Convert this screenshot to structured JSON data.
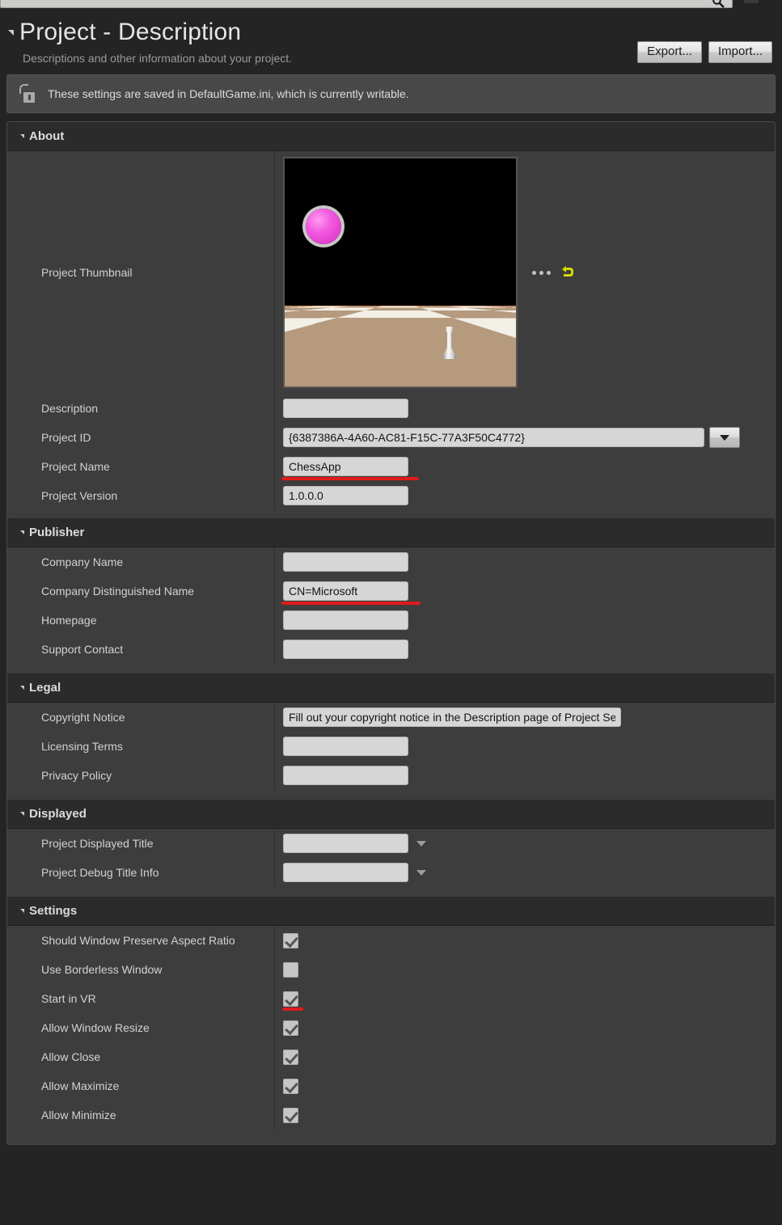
{
  "topbar": {
    "search_value": "",
    "search_icon": "magnifier-icon"
  },
  "header": {
    "title": "Project - Description",
    "subtitle": "Descriptions and other information about your project.",
    "export_label": "Export...",
    "import_label": "Import..."
  },
  "banner": {
    "icon": "unlocked-padlock-icon",
    "message": "These settings are saved in DefaultGame.ini, which is currently writable."
  },
  "sections": {
    "about": {
      "title": "About",
      "thumbnail_label": "Project Thumbnail",
      "thumbnail_browse_icon": "ellipsis-icon",
      "thumbnail_reset_icon": "reset-arrow-icon",
      "description_label": "Description",
      "description_value": "",
      "project_id_label": "Project ID",
      "project_id_value": "{6387386A-4A60-AC81-F15C-77A3F50C4772}",
      "project_name_label": "Project Name",
      "project_name_value": "ChessApp",
      "project_version_label": "Project Version",
      "project_version_value": "1.0.0.0"
    },
    "publisher": {
      "title": "Publisher",
      "company_name_label": "Company Name",
      "company_name_value": "",
      "company_dn_label": "Company Distinguished Name",
      "company_dn_value": "CN=Microsoft",
      "homepage_label": "Homepage",
      "homepage_value": "",
      "support_label": "Support Contact",
      "support_value": ""
    },
    "legal": {
      "title": "Legal",
      "copyright_label": "Copyright Notice",
      "copyright_value": "Fill out your copyright notice in the Description page of Project Settings.",
      "licensing_label": "Licensing Terms",
      "licensing_value": "",
      "privacy_label": "Privacy Policy",
      "privacy_value": ""
    },
    "displayed": {
      "title": "Displayed",
      "displayed_title_label": "Project Displayed Title",
      "displayed_title_value": "",
      "debug_title_label": "Project Debug Title Info",
      "debug_title_value": ""
    },
    "settings": {
      "title": "Settings",
      "items": [
        {
          "label": "Should Window Preserve Aspect Ratio",
          "checked": true
        },
        {
          "label": "Use Borderless Window",
          "checked": false
        },
        {
          "label": "Start in VR",
          "checked": true
        },
        {
          "label": "Allow Window Resize",
          "checked": true
        },
        {
          "label": "Allow Close",
          "checked": true
        },
        {
          "label": "Allow Maximize",
          "checked": true
        },
        {
          "label": "Allow Minimize",
          "checked": true
        }
      ]
    }
  },
  "annotations": {
    "color": "#e01b1b",
    "targets": [
      "project_name_value",
      "company_dn_value",
      "start_in_vr_checkbox"
    ]
  }
}
